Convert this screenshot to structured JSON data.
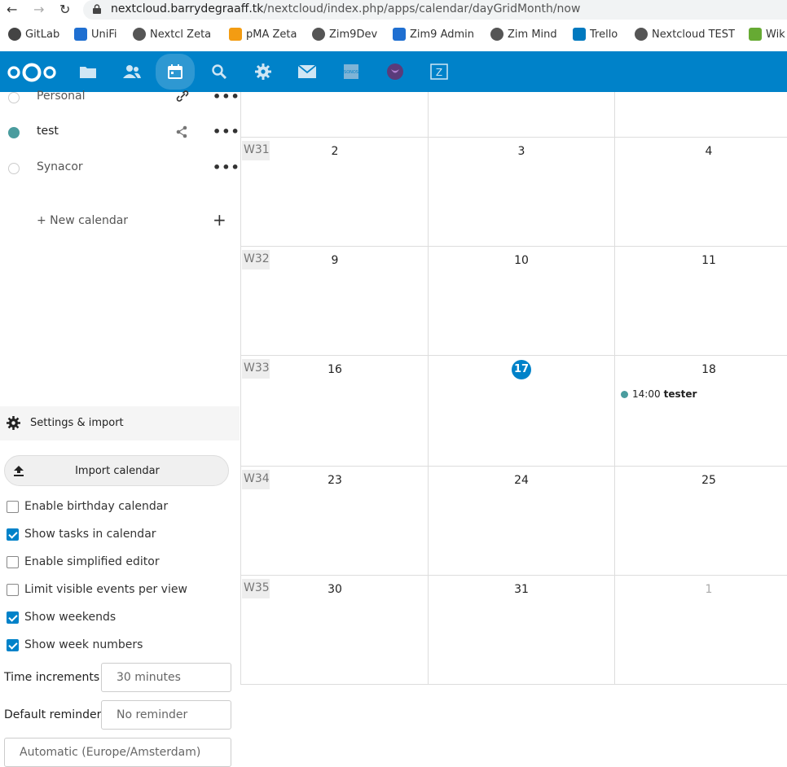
{
  "browser": {
    "url_host": "nextcloud.barrydegraaff.tk",
    "url_path": "/nextcloud/index.php/apps/calendar/dayGridMonth/now",
    "bookmarks": [
      {
        "label": "GitLab",
        "color": "#444"
      },
      {
        "label": "UniFi",
        "color": "#1f6fd1"
      },
      {
        "label": "Nextcl Zeta",
        "color": "#555"
      },
      {
        "label": "pMA Zeta",
        "color": "#f39c12"
      },
      {
        "label": "Zim9Dev",
        "color": "#555"
      },
      {
        "label": "Zim9 Admin",
        "color": "#1f6fd1"
      },
      {
        "label": "Zim Mind",
        "color": "#555"
      },
      {
        "label": "Trello",
        "color": "#0079bf"
      },
      {
        "label": "Nextcloud TEST",
        "color": "#555"
      },
      {
        "label": "Wik",
        "color": "#6a3"
      }
    ]
  },
  "header": {
    "brand_color": "#0082c9",
    "apps": [
      "files-icon",
      "contacts-icon",
      "calendar-icon",
      "search-icon",
      "settings-icon",
      "mail-icon",
      "sonos-icon",
      "privacy-icon",
      "zimbra-icon"
    ]
  },
  "sidebar": {
    "calendars": [
      {
        "name": "Personal",
        "color": "",
        "has_link": true,
        "muted": true
      },
      {
        "name": "test",
        "color": "#4a9c9e",
        "shared": true
      },
      {
        "name": "Synacor",
        "color": ""
      }
    ],
    "new_calendar": "+ New calendar",
    "settings_label": "Settings & import",
    "import_label": "Import calendar",
    "options": [
      {
        "label": "Enable birthday calendar",
        "checked": false
      },
      {
        "label": "Show tasks in calendar",
        "checked": true
      },
      {
        "label": "Enable simplified editor",
        "checked": false
      },
      {
        "label": "Limit visible events per view",
        "checked": false
      },
      {
        "label": "Show weekends",
        "checked": true
      },
      {
        "label": "Show week numbers",
        "checked": true
      }
    ],
    "time_increments_label": "Time increments",
    "time_increments_value": "30 minutes",
    "default_reminder_label": "Default reminder",
    "default_reminder_value": "No reminder",
    "timezone_value": "Automatic (Europe/Amsterdam)"
  },
  "calendar": {
    "weeks": [
      {
        "num": "",
        "days": [
          "",
          "",
          ""
        ]
      },
      {
        "num": "W31",
        "days": [
          "2",
          "3",
          "4"
        ]
      },
      {
        "num": "W32",
        "days": [
          "9",
          "10",
          "11"
        ]
      },
      {
        "num": "W33",
        "days": [
          "16",
          "17",
          "18"
        ],
        "today_index": 1
      },
      {
        "num": "W34",
        "days": [
          "23",
          "24",
          "25"
        ]
      },
      {
        "num": "W35",
        "days": [
          "30",
          "31",
          "1"
        ],
        "other_index": 2
      }
    ],
    "event": {
      "time": "14:00",
      "title": "tester",
      "color": "#4a9c9e"
    }
  }
}
